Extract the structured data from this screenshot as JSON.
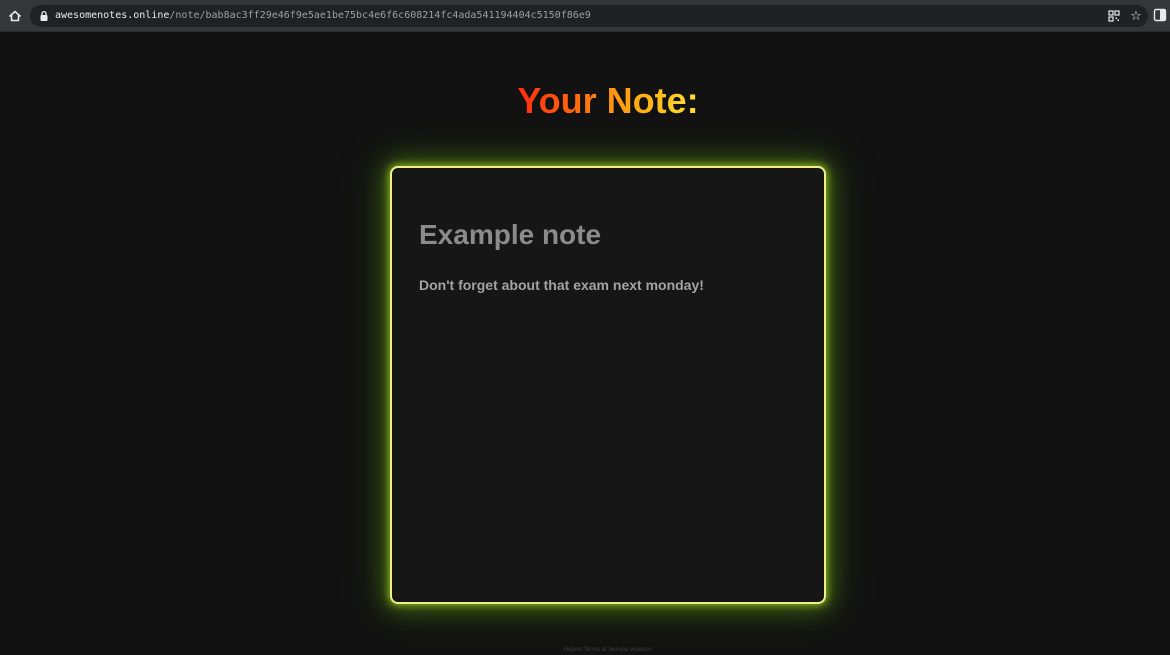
{
  "browser": {
    "url_domain": "awesomenotes.online",
    "url_path": "/note/bab8ac3ff29e46f9e5ae1be75bc4e6f6c608214fc4ada541194404c5150f86e9",
    "icons": [
      "home-icon",
      "lock-icon",
      "qr-code-icon",
      "star-icon",
      "side-panel-icon"
    ]
  },
  "page": {
    "title": "Your Note:",
    "title_gradient": [
      "#ff2a10",
      "#ff9a10",
      "#ffe13a"
    ],
    "background_color": "#121212"
  },
  "note": {
    "title": "Example note",
    "body": "Don't forget about that exam next monday!",
    "border_color": "#f2ec8a",
    "glow_color": "#8ccc22"
  },
  "footer": {
    "report_link": "Report Terms of Service violation"
  }
}
